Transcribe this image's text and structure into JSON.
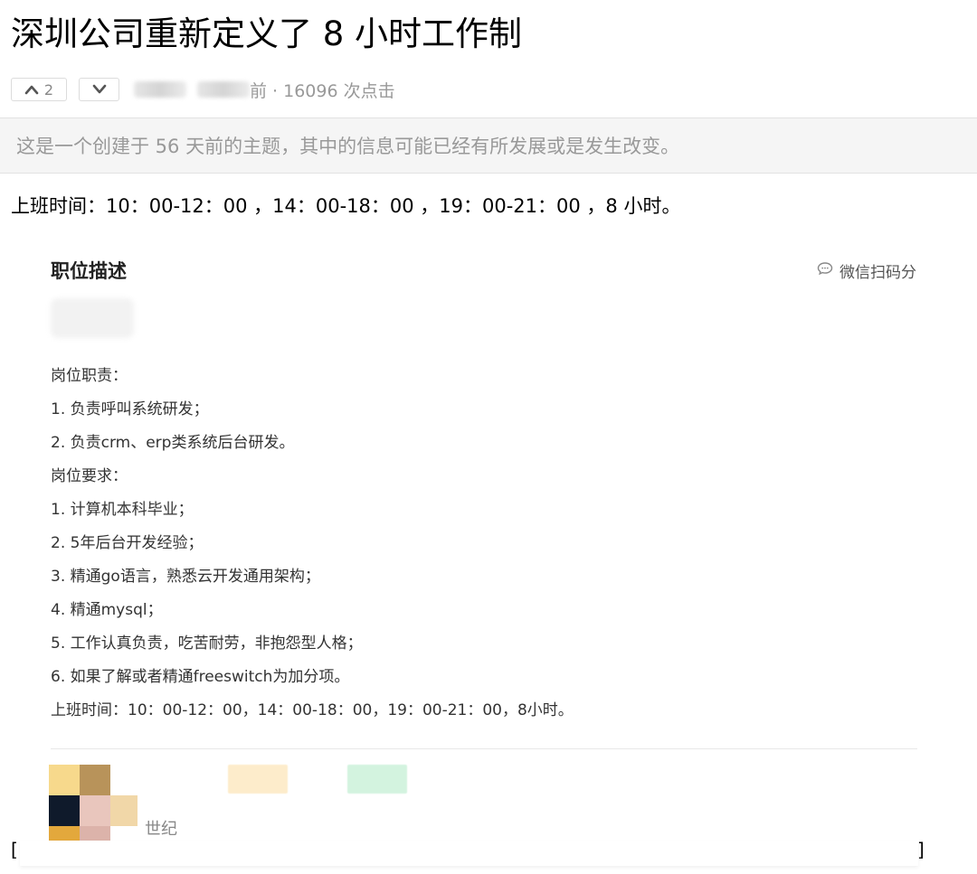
{
  "post": {
    "title": "深圳公司重新定义了 8 小时工作制",
    "votes_up": "2",
    "meta_suffix": "前 · 16096 次点击",
    "notice": "这是一个创建于 56 天前的主题，其中的信息可能已经有所发展或是发生改变。",
    "body_line": "上班时间：10：00-12：00 ，14：00-18：00 ，19：00-21：00 ，8 小时。"
  },
  "screenshot": {
    "heading": "职位描述",
    "share_label": "微信扫码分",
    "lines": [
      "岗位职责：",
      "1. 负责呼叫系统研发；",
      "2. 负责crm、erp类系统后台研发。",
      "岗位要求：",
      "1. 计算机本科毕业；",
      "2. 5年后台开发经验；",
      "3. 精通go语言，熟悉云开发通用架构；",
      "4. 精通mysql；",
      "5. 工作认真负责，吃苦耐劳，非抱怨型人格；",
      "6. 如果了解或者精通freeswitch为加分项。",
      "上班时间：10：00-12：00，14：00-18：00，19：00-21：00，8小时。"
    ],
    "company_fragment": "世纪"
  },
  "brackets": {
    "left": "[",
    "right": "]"
  },
  "icons": {
    "upvote": "chevron-up-icon",
    "downvote": "chevron-down-icon",
    "share": "chat-bubble-icon"
  },
  "colors": {
    "notice_bg": "#f5f5f5",
    "muted_text": "#999999"
  }
}
